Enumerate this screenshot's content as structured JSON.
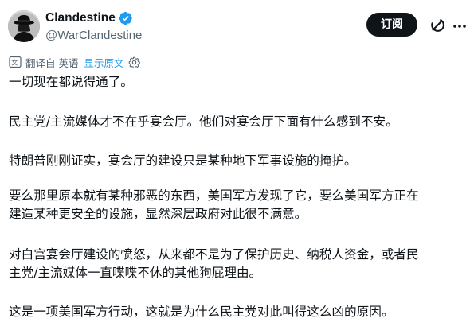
{
  "author": {
    "display_name": "Clandestine",
    "handle": "@WarClandestine",
    "verified": true,
    "avatar_icon": "fedora-silhouette-avatar"
  },
  "actions": {
    "subscribe_label": "订阅",
    "grok_icon": "grok-icon",
    "more_icon": "more-icon"
  },
  "translation": {
    "label": "翻译自 英语",
    "show_original": "显示原文",
    "icon": "translate-icon",
    "settings_icon": "gear-icon"
  },
  "tweet": {
    "paragraphs": [
      "一切现在都说得通了。",
      "民主党/主流媒体才不在乎宴会厅。他们对宴会厅下面有什么感到不安。",
      "特朗普刚刚证实，宴会厅的建设只是某种地下军事设施的掩护。",
      "要么那里原本就有某种邪恶的东西，美国军方发现了它，要么美国军方正在\n建造某种更安全的设施，显然深层政府对此很不满意。",
      "对白宫宴会厅建设的愤怒，从来都不是为了保护历史、纳税人资金，或者民\n主党/主流媒体一直喋喋不休的其他狗屁理由。",
      "这是一项美国军方行动，这就是为什么民主党对此叫得这么凶的原因。"
    ]
  },
  "colors": {
    "text": "#0f1419",
    "secondary": "#536471",
    "link": "#1d9bf0",
    "button_bg": "#0f1419",
    "verified": "#1d9bf0"
  }
}
